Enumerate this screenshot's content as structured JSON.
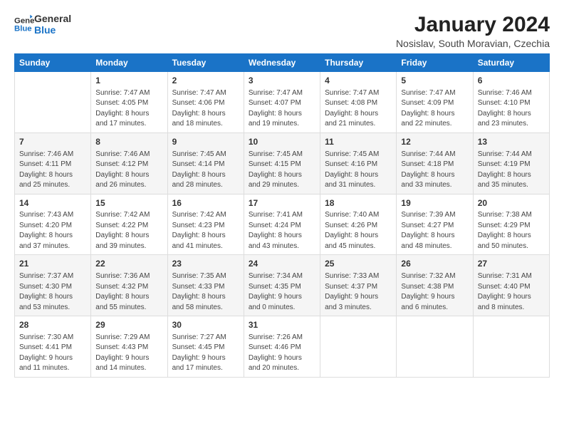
{
  "logo": {
    "line1": "General",
    "line2": "Blue"
  },
  "title": "January 2024",
  "subtitle": "Nosislav, South Moravian, Czechia",
  "days_of_week": [
    "Sunday",
    "Monday",
    "Tuesday",
    "Wednesday",
    "Thursday",
    "Friday",
    "Saturday"
  ],
  "weeks": [
    [
      {
        "num": "",
        "info": ""
      },
      {
        "num": "1",
        "info": "Sunrise: 7:47 AM\nSunset: 4:05 PM\nDaylight: 8 hours\nand 17 minutes."
      },
      {
        "num": "2",
        "info": "Sunrise: 7:47 AM\nSunset: 4:06 PM\nDaylight: 8 hours\nand 18 minutes."
      },
      {
        "num": "3",
        "info": "Sunrise: 7:47 AM\nSunset: 4:07 PM\nDaylight: 8 hours\nand 19 minutes."
      },
      {
        "num": "4",
        "info": "Sunrise: 7:47 AM\nSunset: 4:08 PM\nDaylight: 8 hours\nand 21 minutes."
      },
      {
        "num": "5",
        "info": "Sunrise: 7:47 AM\nSunset: 4:09 PM\nDaylight: 8 hours\nand 22 minutes."
      },
      {
        "num": "6",
        "info": "Sunrise: 7:46 AM\nSunset: 4:10 PM\nDaylight: 8 hours\nand 23 minutes."
      }
    ],
    [
      {
        "num": "7",
        "info": "Sunrise: 7:46 AM\nSunset: 4:11 PM\nDaylight: 8 hours\nand 25 minutes."
      },
      {
        "num": "8",
        "info": "Sunrise: 7:46 AM\nSunset: 4:12 PM\nDaylight: 8 hours\nand 26 minutes."
      },
      {
        "num": "9",
        "info": "Sunrise: 7:45 AM\nSunset: 4:14 PM\nDaylight: 8 hours\nand 28 minutes."
      },
      {
        "num": "10",
        "info": "Sunrise: 7:45 AM\nSunset: 4:15 PM\nDaylight: 8 hours\nand 29 minutes."
      },
      {
        "num": "11",
        "info": "Sunrise: 7:45 AM\nSunset: 4:16 PM\nDaylight: 8 hours\nand 31 minutes."
      },
      {
        "num": "12",
        "info": "Sunrise: 7:44 AM\nSunset: 4:18 PM\nDaylight: 8 hours\nand 33 minutes."
      },
      {
        "num": "13",
        "info": "Sunrise: 7:44 AM\nSunset: 4:19 PM\nDaylight: 8 hours\nand 35 minutes."
      }
    ],
    [
      {
        "num": "14",
        "info": "Sunrise: 7:43 AM\nSunset: 4:20 PM\nDaylight: 8 hours\nand 37 minutes."
      },
      {
        "num": "15",
        "info": "Sunrise: 7:42 AM\nSunset: 4:22 PM\nDaylight: 8 hours\nand 39 minutes."
      },
      {
        "num": "16",
        "info": "Sunrise: 7:42 AM\nSunset: 4:23 PM\nDaylight: 8 hours\nand 41 minutes."
      },
      {
        "num": "17",
        "info": "Sunrise: 7:41 AM\nSunset: 4:24 PM\nDaylight: 8 hours\nand 43 minutes."
      },
      {
        "num": "18",
        "info": "Sunrise: 7:40 AM\nSunset: 4:26 PM\nDaylight: 8 hours\nand 45 minutes."
      },
      {
        "num": "19",
        "info": "Sunrise: 7:39 AM\nSunset: 4:27 PM\nDaylight: 8 hours\nand 48 minutes."
      },
      {
        "num": "20",
        "info": "Sunrise: 7:38 AM\nSunset: 4:29 PM\nDaylight: 8 hours\nand 50 minutes."
      }
    ],
    [
      {
        "num": "21",
        "info": "Sunrise: 7:37 AM\nSunset: 4:30 PM\nDaylight: 8 hours\nand 53 minutes."
      },
      {
        "num": "22",
        "info": "Sunrise: 7:36 AM\nSunset: 4:32 PM\nDaylight: 8 hours\nand 55 minutes."
      },
      {
        "num": "23",
        "info": "Sunrise: 7:35 AM\nSunset: 4:33 PM\nDaylight: 8 hours\nand 58 minutes."
      },
      {
        "num": "24",
        "info": "Sunrise: 7:34 AM\nSunset: 4:35 PM\nDaylight: 9 hours\nand 0 minutes."
      },
      {
        "num": "25",
        "info": "Sunrise: 7:33 AM\nSunset: 4:37 PM\nDaylight: 9 hours\nand 3 minutes."
      },
      {
        "num": "26",
        "info": "Sunrise: 7:32 AM\nSunset: 4:38 PM\nDaylight: 9 hours\nand 6 minutes."
      },
      {
        "num": "27",
        "info": "Sunrise: 7:31 AM\nSunset: 4:40 PM\nDaylight: 9 hours\nand 8 minutes."
      }
    ],
    [
      {
        "num": "28",
        "info": "Sunrise: 7:30 AM\nSunset: 4:41 PM\nDaylight: 9 hours\nand 11 minutes."
      },
      {
        "num": "29",
        "info": "Sunrise: 7:29 AM\nSunset: 4:43 PM\nDaylight: 9 hours\nand 14 minutes."
      },
      {
        "num": "30",
        "info": "Sunrise: 7:27 AM\nSunset: 4:45 PM\nDaylight: 9 hours\nand 17 minutes."
      },
      {
        "num": "31",
        "info": "Sunrise: 7:26 AM\nSunset: 4:46 PM\nDaylight: 9 hours\nand 20 minutes."
      },
      {
        "num": "",
        "info": ""
      },
      {
        "num": "",
        "info": ""
      },
      {
        "num": "",
        "info": ""
      }
    ]
  ]
}
